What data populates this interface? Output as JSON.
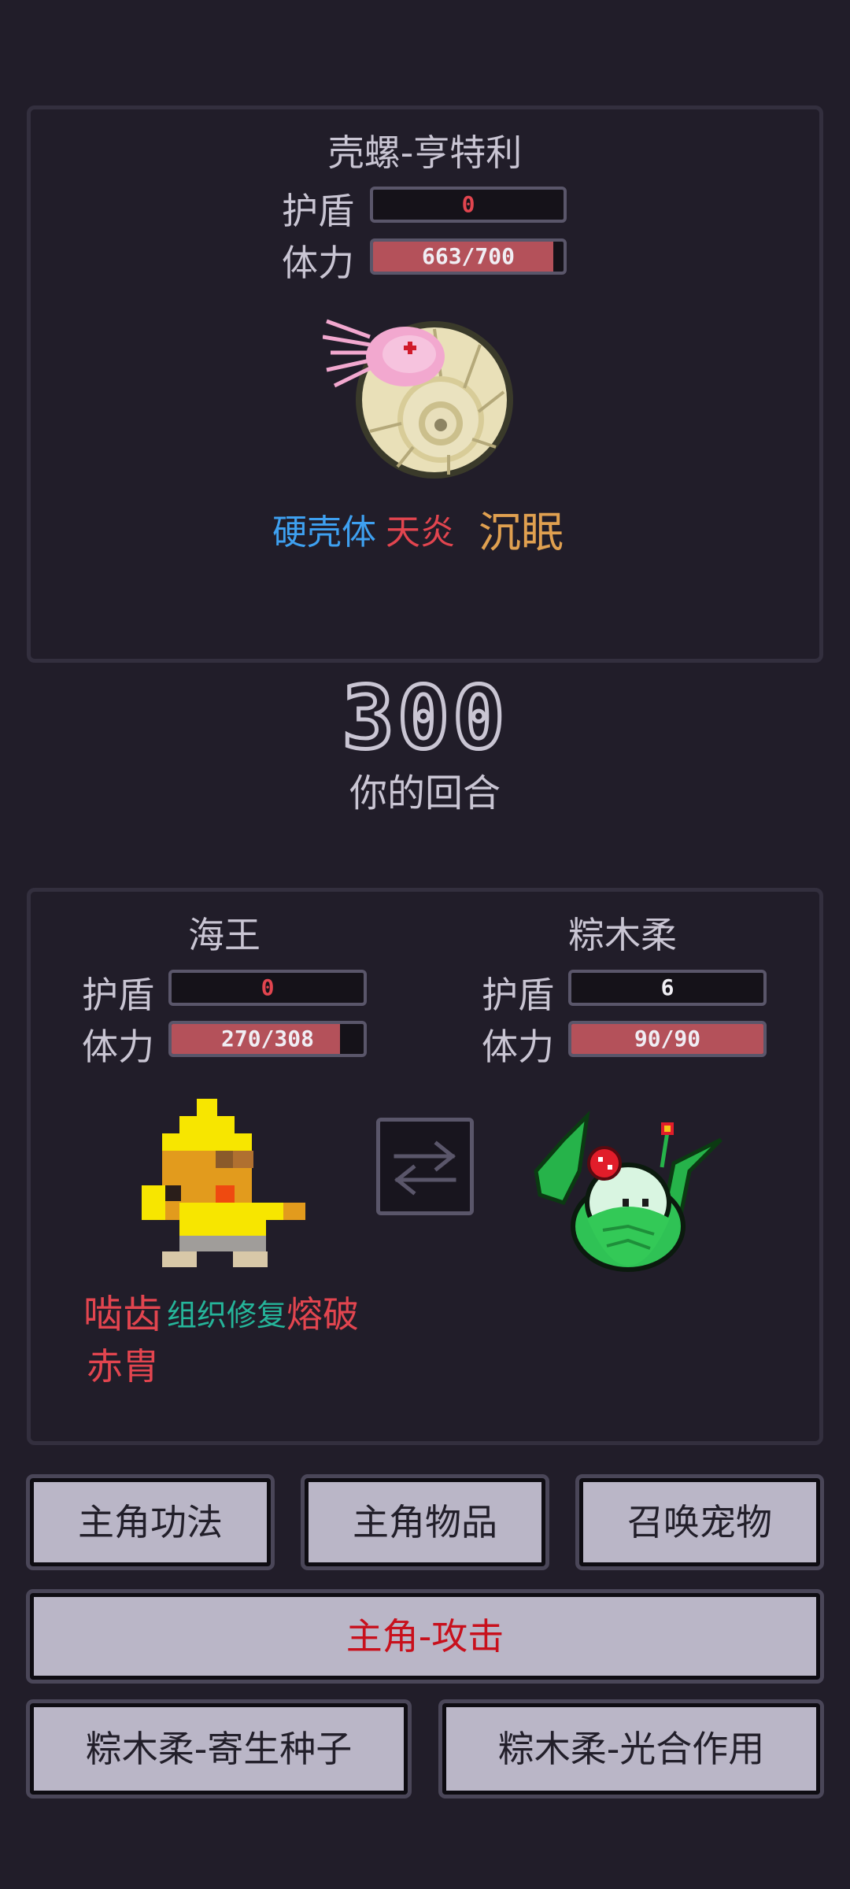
{
  "enemy": {
    "name": "壳螺-亨特利",
    "shield_label": "护盾",
    "shield_value": "0",
    "hp_label": "体力",
    "hp_text": "663/700",
    "hp_fraction": 0.947,
    "traits": [
      "硬壳体",
      "天炎",
      "沉眠"
    ]
  },
  "turn": {
    "number": "300",
    "label": "你的回合"
  },
  "party": [
    {
      "name": "海王",
      "shield_label": "护盾",
      "shield_value": "0",
      "hp_label": "体力",
      "hp_text": "270/308",
      "hp_fraction": 0.877,
      "traits": [
        "啮齿",
        "组织修复",
        "熔破",
        "赤胄"
      ]
    },
    {
      "name": "粽木柔",
      "shield_label": "护盾",
      "shield_value": "6",
      "hp_label": "体力",
      "hp_text": "90/90",
      "hp_fraction": 1.0
    }
  ],
  "actions": {
    "skills": "主角功法",
    "items": "主角物品",
    "summon": "召唤宠物",
    "attack": "主角-攻击",
    "seed": "粽木柔-寄生种子",
    "photo": "粽木柔-光合作用"
  },
  "colors": {
    "background": "#211d29",
    "hp_fill": "#b4515a",
    "trait_blue": "#3ea0f0",
    "trait_red": "#e2454f",
    "trait_orange": "#e0a050",
    "trait_teal": "#25b59a",
    "attack_text": "#c8101c"
  },
  "icons": [
    "nautilus-sprite",
    "capybara-sprite",
    "plant-sprite",
    "swap-arrows-icon"
  ]
}
